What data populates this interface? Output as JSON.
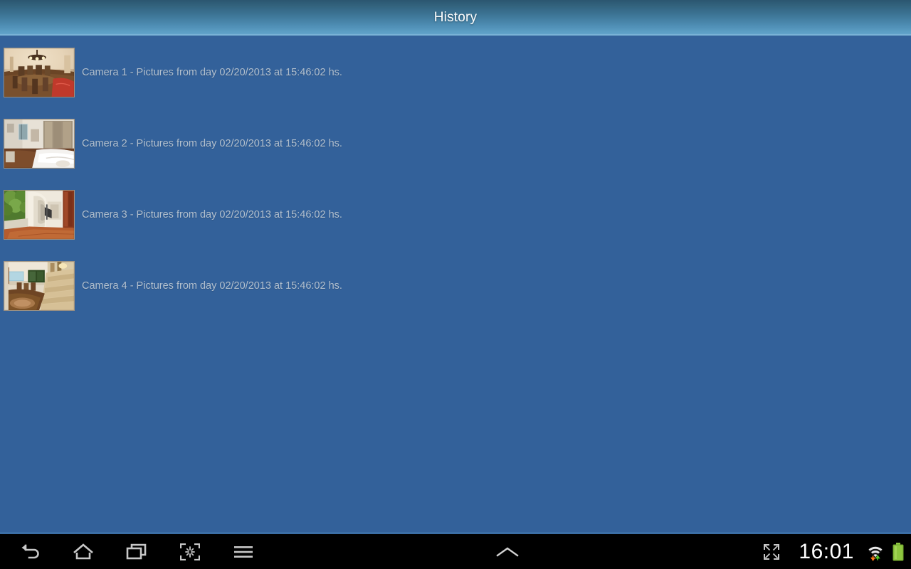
{
  "window": {
    "title": "History"
  },
  "list": {
    "items": [
      {
        "label": "Camera 1 - Pictures from day 02/20/2013 at 15:46:02 hs.",
        "thumbnail": "dining-room-thumbnail"
      },
      {
        "label": "Camera 2 - Pictures from day 02/20/2013 at 15:46:02 hs.",
        "thumbnail": "bedroom-thumbnail"
      },
      {
        "label": "Camera 3 - Pictures from day 02/20/2013 at 15:46:02 hs.",
        "thumbnail": "outdoor-corridor-thumbnail"
      },
      {
        "label": "Camera 4 - Pictures from day 02/20/2013 at 15:46:02 hs.",
        "thumbnail": "living-room-stairs-thumbnail"
      }
    ]
  },
  "navbar": {
    "back_icon": "back-arrow-icon",
    "home_icon": "home-icon",
    "recents_icon": "recent-apps-icon",
    "screenshot_icon": "screenshot-capture-icon",
    "menu_icon": "menu-icon",
    "expand_icon": "chevron-up-icon",
    "fullscreen_icon": "fullscreen-expand-icon",
    "clock": "16:01",
    "wifi_icon": "wifi-signal-icon",
    "battery_icon": "battery-full-icon"
  },
  "colors": {
    "background": "#33619a",
    "title_gradient_top": "#2b5670",
    "title_gradient_bottom": "#6aa8cd",
    "title_text": "#ffffff",
    "item_text": "#b2c0cf",
    "navbar_background": "#000000",
    "navbar_border": "#3b6ea5",
    "navbar_icon": "#c8c8c8",
    "battery_green": "#8ec63f",
    "clock_text": "#ffffff"
  }
}
